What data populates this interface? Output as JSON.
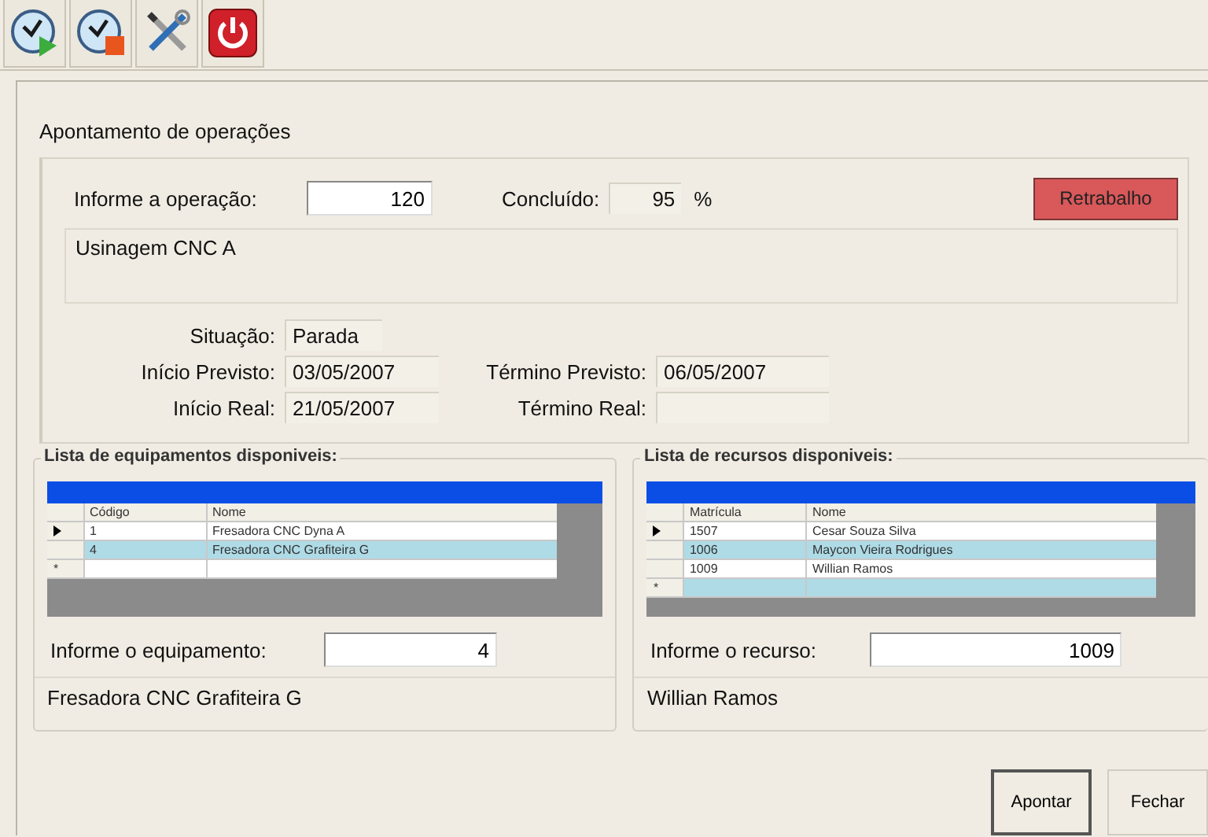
{
  "toolbar": [
    {
      "kind": "start"
    },
    {
      "kind": "stop"
    },
    {
      "kind": "tools"
    },
    {
      "kind": "power"
    }
  ],
  "operation": {
    "title": "Apontamento de operações",
    "label": "Informe a operação:",
    "value": "120",
    "done_label": "Concluído:",
    "done_value": "95",
    "done_unit": "%",
    "rework_button": "Retrabalho",
    "description": "Usinagem CNC A",
    "status_label": "Situação:",
    "status": "Parada",
    "planned_start_label": "Início Previsto:",
    "planned_start": "03/05/2007",
    "planned_end_label": "Término Previsto:",
    "planned_end": "06/05/2007",
    "real_start_label": "Início Real:",
    "real_start": "21/05/2007",
    "real_end_label": "Término Real:"
  },
  "equipment": {
    "title": "Lista de equipamentos disponiveis:",
    "columns": [
      "Código",
      "Nome"
    ],
    "rows": [
      {
        "cells": [
          "1",
          "Fresadora CNC Dyna A"
        ],
        "current": true,
        "selected": false
      },
      {
        "cells": [
          "4",
          "Fresadora CNC Grafiteira G"
        ],
        "current": false,
        "selected": true
      }
    ],
    "new_row_marker": "*",
    "label": "Informe o equipamento:",
    "value": "4",
    "result": "Fresadora CNC Grafiteira G"
  },
  "resources": {
    "title": "Lista de recursos disponiveis:",
    "columns": [
      "Matrícula",
      "Nome"
    ],
    "rows": [
      {
        "cells": [
          "1507",
          "Cesar Souza Silva"
        ],
        "current": true,
        "selected": false
      },
      {
        "cells": [
          "1006",
          "Maycon Vieira Rodrigues"
        ],
        "current": false,
        "selected": true
      },
      {
        "cells": [
          "1009",
          "Willian Ramos"
        ],
        "current": false,
        "selected": false
      }
    ],
    "new_row_marker": "*",
    "label": "Informe o recurso:",
    "value": "1009",
    "result": "Willian Ramos"
  },
  "buttons": [
    "Apontar",
    "Fechar"
  ]
}
